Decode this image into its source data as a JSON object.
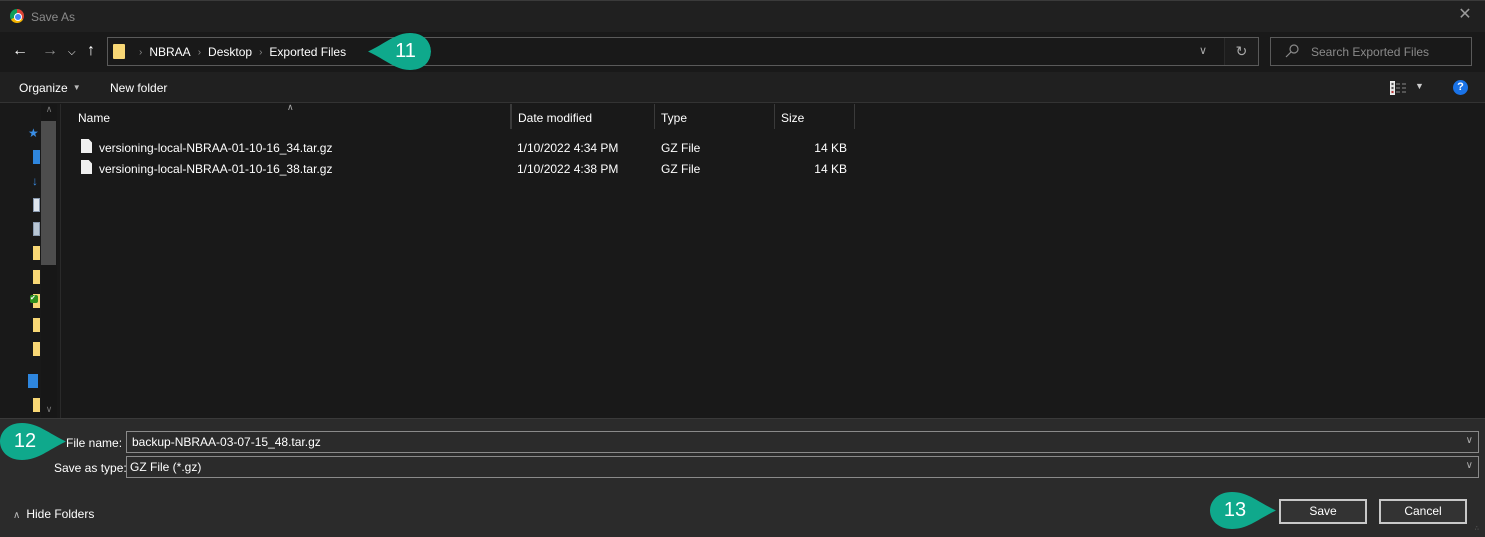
{
  "window": {
    "title": "Save As",
    "app_icon": "chrome-icon",
    "close_icon": "close-icon"
  },
  "nav": {
    "back_icon": "arrow-left-icon",
    "forward_icon": "arrow-right-icon",
    "recent_icon": "chevron-down-icon",
    "up_icon": "arrow-up-icon",
    "breadcrumb": [
      "NBRAA",
      "Desktop",
      "Exported Files"
    ],
    "refresh_icon": "refresh-icon",
    "search_placeholder": "Search Exported Files"
  },
  "toolbar": {
    "organize_label": "Organize",
    "new_folder_label": "New folder",
    "view_icon": "details-view-icon",
    "help_icon": "help-icon",
    "help_glyph": "?"
  },
  "sidebar": {
    "items": [
      {
        "icon": "quick-access-star-icon"
      },
      {
        "icon": "desktop-icon"
      },
      {
        "icon": "downloads-icon"
      },
      {
        "icon": "documents-icon"
      },
      {
        "icon": "pictures-icon"
      },
      {
        "icon": "folder-icon"
      },
      {
        "icon": "folder-icon"
      },
      {
        "icon": "synced-folder-icon"
      },
      {
        "icon": "folder-icon"
      },
      {
        "icon": "folder-icon"
      },
      {
        "icon": "building-icon"
      },
      {
        "icon": "folder-icon"
      }
    ]
  },
  "files": {
    "columns": [
      "Name",
      "Date modified",
      "Type",
      "Size"
    ],
    "rows": [
      {
        "name": "versioning-local-NBRAA-01-10-16_34.tar.gz",
        "date": "1/10/2022 4:34 PM",
        "type": "GZ File",
        "size": "14 KB"
      },
      {
        "name": "versioning-local-NBRAA-01-10-16_38.tar.gz",
        "date": "1/10/2022 4:38 PM",
        "type": "GZ File",
        "size": "14 KB"
      }
    ]
  },
  "form": {
    "file_name_label": "File name:",
    "file_name_value": "backup-NBRAA-03-07-15_48.tar.gz",
    "save_type_label": "Save as type:",
    "save_type_value": "GZ File (*.gz)",
    "hide_folders_label": "Hide Folders",
    "save_label": "Save",
    "cancel_label": "Cancel"
  },
  "callouts": {
    "step_11": "11",
    "step_12": "12",
    "step_13": "13",
    "color": "#0fa98c"
  }
}
